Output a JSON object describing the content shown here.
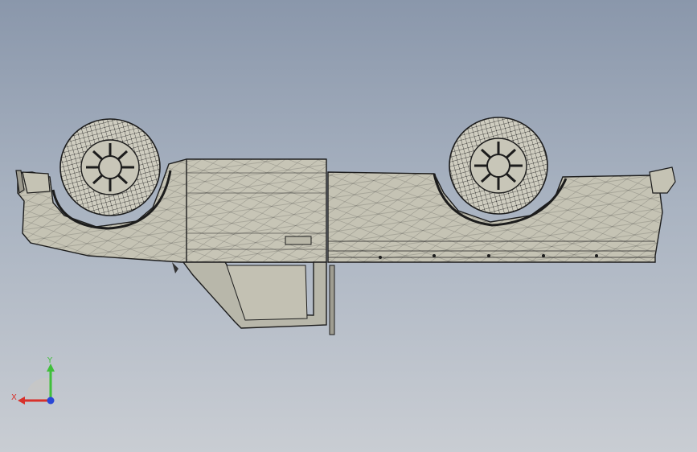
{
  "viewport": {
    "background_top": "#8a97ab",
    "background_bottom": "#c9cdd3",
    "display_mode": "wireframe-shaded",
    "model_color": "#c5c3b4",
    "edge_color": "#1c1c1c"
  },
  "triad": {
    "x_label": "X",
    "y_label": "Y",
    "x_color": "#d8312b",
    "y_color": "#3fbf3a",
    "z_color": "#2a47d6"
  }
}
